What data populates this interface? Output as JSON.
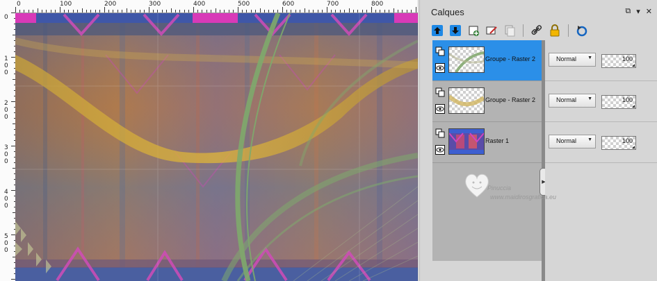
{
  "ruler": {
    "top_labels": [
      "0",
      "100",
      "200",
      "300",
      "400",
      "500",
      "600",
      "700",
      "800"
    ],
    "left_labels": [
      "0",
      "1",
      "0",
      "0",
      "2",
      "0",
      "0",
      "3",
      "0",
      "0",
      "4",
      "0",
      "0",
      "5",
      "0",
      "0"
    ]
  },
  "panel": {
    "title": "Calques",
    "controls": [
      "⧉",
      "▾",
      "✕"
    ]
  },
  "toolbar": {
    "buttons": [
      "move-up",
      "move-down",
      "new-layer",
      "edit",
      "duplicate",
      "link",
      "lock",
      "refresh"
    ]
  },
  "layers": [
    {
      "name": "Groupe - Raster 2",
      "blend": "Normal",
      "opacity": "100",
      "selected": true
    },
    {
      "name": "Groupe - Raster 2",
      "blend": "Normal",
      "opacity": "100",
      "selected": false
    },
    {
      "name": "Raster 1",
      "blend": "Normal",
      "opacity": "100",
      "selected": false
    }
  ],
  "watermark": {
    "line1": "Pinuccia",
    "line2": "www.maidirosgrafica.eu"
  },
  "colors": {
    "selection": "#2b8fe8",
    "panel": "#d6d6d6",
    "list": "#b3b3b3"
  }
}
